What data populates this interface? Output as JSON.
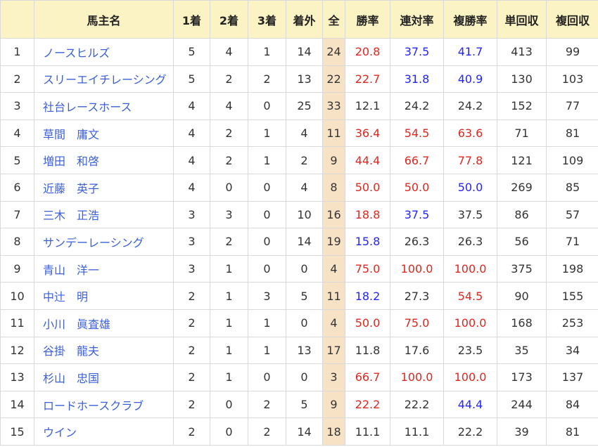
{
  "headers": [
    "",
    "馬主名",
    "1着",
    "2着",
    "3着",
    "着外",
    "全",
    "勝率",
    "連対率",
    "複勝率",
    "単回収",
    "複回収"
  ],
  "rows": [
    {
      "rank": "1",
      "owner": "ノースヒルズ",
      "first": "5",
      "second": "4",
      "third": "1",
      "unplaced": "14",
      "total": "24",
      "win_rate": "20.8",
      "quinella_rate": "37.5",
      "show_rate": "41.7",
      "win_return": "413",
      "show_return": "99",
      "win_rate_color": "red",
      "quinella_rate_color": "blue",
      "show_rate_color": "blue"
    },
    {
      "rank": "2",
      "owner": "スリーエイチレーシング",
      "first": "5",
      "second": "2",
      "third": "2",
      "unplaced": "13",
      "total": "22",
      "win_rate": "22.7",
      "quinella_rate": "31.8",
      "show_rate": "40.9",
      "win_return": "130",
      "show_return": "103",
      "win_rate_color": "red",
      "quinella_rate_color": "blue",
      "show_rate_color": "blue"
    },
    {
      "rank": "3",
      "owner": "社台レースホース",
      "first": "4",
      "second": "4",
      "third": "0",
      "unplaced": "25",
      "total": "33",
      "win_rate": "12.1",
      "quinella_rate": "24.2",
      "show_rate": "24.2",
      "win_return": "152",
      "show_return": "77",
      "win_rate_color": "plain",
      "quinella_rate_color": "plain",
      "show_rate_color": "plain"
    },
    {
      "rank": "4",
      "owner": "草間　庸文",
      "first": "4",
      "second": "2",
      "third": "1",
      "unplaced": "4",
      "total": "11",
      "win_rate": "36.4",
      "quinella_rate": "54.5",
      "show_rate": "63.6",
      "win_return": "71",
      "show_return": "81",
      "win_rate_color": "red",
      "quinella_rate_color": "red",
      "show_rate_color": "red"
    },
    {
      "rank": "5",
      "owner": "増田　和啓",
      "first": "4",
      "second": "2",
      "third": "1",
      "unplaced": "2",
      "total": "9",
      "win_rate": "44.4",
      "quinella_rate": "66.7",
      "show_rate": "77.8",
      "win_return": "121",
      "show_return": "109",
      "win_rate_color": "red",
      "quinella_rate_color": "red",
      "show_rate_color": "red"
    },
    {
      "rank": "6",
      "owner": "近藤　英子",
      "first": "4",
      "second": "0",
      "third": "0",
      "unplaced": "4",
      "total": "8",
      "win_rate": "50.0",
      "quinella_rate": "50.0",
      "show_rate": "50.0",
      "win_return": "269",
      "show_return": "85",
      "win_rate_color": "red",
      "quinella_rate_color": "red",
      "show_rate_color": "blue"
    },
    {
      "rank": "7",
      "owner": "三木　正浩",
      "first": "3",
      "second": "3",
      "third": "0",
      "unplaced": "10",
      "total": "16",
      "win_rate": "18.8",
      "quinella_rate": "37.5",
      "show_rate": "37.5",
      "win_return": "86",
      "show_return": "57",
      "win_rate_color": "red",
      "quinella_rate_color": "blue",
      "show_rate_color": "plain"
    },
    {
      "rank": "8",
      "owner": "サンデーレーシング",
      "first": "3",
      "second": "2",
      "third": "0",
      "unplaced": "14",
      "total": "19",
      "win_rate": "15.8",
      "quinella_rate": "26.3",
      "show_rate": "26.3",
      "win_return": "56",
      "show_return": "71",
      "win_rate_color": "blue",
      "quinella_rate_color": "plain",
      "show_rate_color": "plain"
    },
    {
      "rank": "9",
      "owner": "青山　洋一",
      "first": "3",
      "second": "1",
      "third": "0",
      "unplaced": "0",
      "total": "4",
      "win_rate": "75.0",
      "quinella_rate": "100.0",
      "show_rate": "100.0",
      "win_return": "375",
      "show_return": "198",
      "win_rate_color": "red",
      "quinella_rate_color": "red",
      "show_rate_color": "red"
    },
    {
      "rank": "10",
      "owner": "中辻　明",
      "first": "2",
      "second": "1",
      "third": "3",
      "unplaced": "5",
      "total": "11",
      "win_rate": "18.2",
      "quinella_rate": "27.3",
      "show_rate": "54.5",
      "win_return": "90",
      "show_return": "155",
      "win_rate_color": "blue",
      "quinella_rate_color": "plain",
      "show_rate_color": "red"
    },
    {
      "rank": "11",
      "owner": "小川　眞査雄",
      "first": "2",
      "second": "1",
      "third": "1",
      "unplaced": "0",
      "total": "4",
      "win_rate": "50.0",
      "quinella_rate": "75.0",
      "show_rate": "100.0",
      "win_return": "168",
      "show_return": "253",
      "win_rate_color": "red",
      "quinella_rate_color": "red",
      "show_rate_color": "red"
    },
    {
      "rank": "12",
      "owner": "谷掛　龍夫",
      "first": "2",
      "second": "1",
      "third": "1",
      "unplaced": "13",
      "total": "17",
      "win_rate": "11.8",
      "quinella_rate": "17.6",
      "show_rate": "23.5",
      "win_return": "35",
      "show_return": "34",
      "win_rate_color": "plain",
      "quinella_rate_color": "plain",
      "show_rate_color": "plain"
    },
    {
      "rank": "13",
      "owner": "杉山　忠国",
      "first": "2",
      "second": "1",
      "third": "0",
      "unplaced": "0",
      "total": "3",
      "win_rate": "66.7",
      "quinella_rate": "100.0",
      "show_rate": "100.0",
      "win_return": "173",
      "show_return": "137",
      "win_rate_color": "red",
      "quinella_rate_color": "red",
      "show_rate_color": "red"
    },
    {
      "rank": "14",
      "owner": "ロードホースクラブ",
      "first": "2",
      "second": "0",
      "third": "2",
      "unplaced": "5",
      "total": "9",
      "win_rate": "22.2",
      "quinella_rate": "22.2",
      "show_rate": "44.4",
      "win_return": "244",
      "show_return": "84",
      "win_rate_color": "red",
      "quinella_rate_color": "plain",
      "show_rate_color": "blue"
    },
    {
      "rank": "15",
      "owner": "ウイン",
      "first": "2",
      "second": "0",
      "third": "2",
      "unplaced": "14",
      "total": "18",
      "win_rate": "11.1",
      "quinella_rate": "11.1",
      "show_rate": "22.2",
      "win_return": "39",
      "show_return": "81",
      "win_rate_color": "plain",
      "quinella_rate_color": "plain",
      "show_rate_color": "plain"
    }
  ]
}
